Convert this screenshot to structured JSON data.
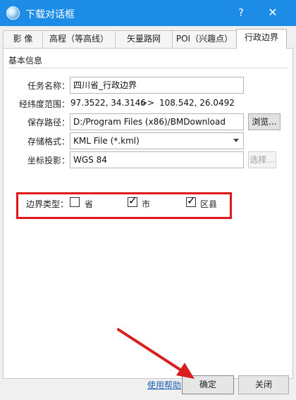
{
  "window": {
    "title": "下载对话框",
    "help_label": "?",
    "close_label": "✕"
  },
  "tabs": [
    {
      "label": "影 像"
    },
    {
      "label": "高程（等高线）"
    },
    {
      "label": "矢量路网"
    },
    {
      "label": "POI（兴趣点）"
    },
    {
      "label": "行政边界"
    }
  ],
  "active_tab": 4,
  "group": {
    "title": "基本信息"
  },
  "fields": {
    "task_name": {
      "label": "任务名称：",
      "value": "四川省_行政边界"
    },
    "range": {
      "label": "经纬度范围：",
      "from": "97.3522, 34.3146",
      "sep": ">>",
      "to": "108.542, 26.0492"
    },
    "save_path": {
      "label": "保存路径：",
      "value": "D:/Program Files (x86)/BMDownload",
      "browse_label": "浏览..."
    },
    "format": {
      "label": "存储格式：",
      "value": "KML File (*.kml)"
    },
    "projection": {
      "label": "坐标投影：",
      "value": "WGS 84",
      "select_label": "选择..."
    }
  },
  "boundary": {
    "label": "边界类型：",
    "options": [
      {
        "label": "省",
        "checked": false
      },
      {
        "label": "市",
        "checked": true
      },
      {
        "label": "区县",
        "checked": true
      }
    ]
  },
  "footer": {
    "help_link": "使用帮助",
    "ok_label": "确定",
    "close_label": "关闭"
  },
  "colors": {
    "titlebar": "#1d8ce6",
    "highlight_box": "#e0161c",
    "arrow": "#d81e1e"
  }
}
